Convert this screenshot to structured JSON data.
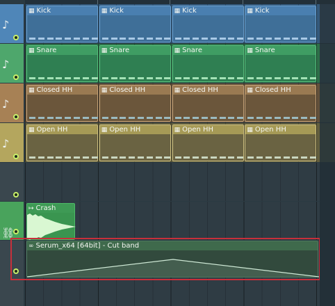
{
  "patterns": [
    {
      "name": "Kick",
      "clips": [
        "Kick",
        "Kick",
        "Kick",
        "Kick"
      ]
    },
    {
      "name": "Snare",
      "clips": [
        "Snare",
        "Snare",
        "Snare",
        "Snare"
      ]
    },
    {
      "name": "Closed HH",
      "clips": [
        "Closed HH",
        "Closed HH",
        "Closed HH",
        "Closed HH"
      ]
    },
    {
      "name": "Open HH",
      "clips": [
        "Open HH",
        "Open HH",
        "Open HH",
        "Open HH"
      ]
    }
  ],
  "audio_clip": {
    "label": "Crash"
  },
  "automation_clip": {
    "label": "Serum_x64 [64bit] - Cut band",
    "selected": true
  },
  "colors": {
    "kick": "#4a7fb0",
    "snare": "#3f9d63",
    "closed_hh": "#9a7a52",
    "open_hh": "#a69a56",
    "audio": "#3e9a55",
    "automation": "#3f6a4c",
    "selection": "#c8303b"
  },
  "icons": {
    "pattern_track": "music-note-icon",
    "audio_track": "link-icon",
    "clip_pattern": "pattern-icon",
    "clip_audio": "audio-clip-icon",
    "clip_automation": "automation-link-icon"
  }
}
